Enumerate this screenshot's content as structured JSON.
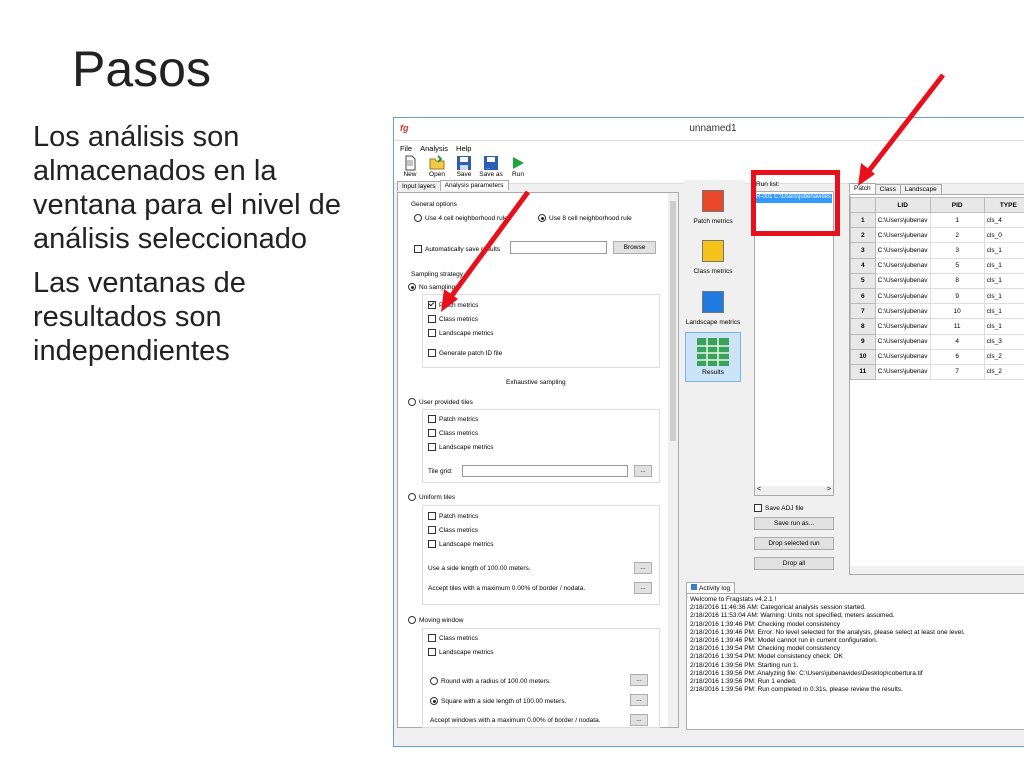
{
  "slide": {
    "title": "Pasos",
    "bullets": [
      "Los análisis son almacenados en la ventana para el nivel de análisis seleccionado",
      "Las ventanas de resultados son independientes"
    ]
  },
  "window": {
    "title": "unnamed1",
    "menu": [
      "File",
      "Analysis",
      "Help"
    ],
    "toolbar": [
      "New",
      "Open",
      "Save",
      "Save as",
      "Run"
    ]
  },
  "left_panel": {
    "tabs": [
      "Input layers",
      "Analysis parameters"
    ],
    "general_options_label": "General options",
    "rule4": "Use 4 cell neighborhood rule",
    "rule8": "Use 8 cell neighborhood rule",
    "auto_save": "Automatically save results",
    "browse": "Browse",
    "sampling_label": "Sampling strategy",
    "no_sampling": "No sampling",
    "patch_metrics": "Patch metrics",
    "class_metrics": "Class metrics",
    "landscape_metrics": "Landscape metrics",
    "generate_patch_id": "Generate patch ID file",
    "exhaustive_sampling": "Exhaustive sampling",
    "user_provided_tiles": "User provided tiles",
    "tile_grid": "Tile grid:",
    "ellipsis": "...",
    "uniform_tiles": "Uniform tiles",
    "side_length": "Use a side length of 100.00 meters.",
    "accept_tiles": "Accept tiles with a maximum 0.00% of border / nodata.",
    "moving_window": "Moving window",
    "round_radius": "Round with a radius of 100.00 meters.",
    "square_side": "Square with a side length of 100.00 meters.",
    "accept_windows": "Accept windows with a maximum 0.00% of border / nodata."
  },
  "metrics_panel": {
    "items": [
      {
        "label": "Patch metrics",
        "color": "#e8472a"
      },
      {
        "label": "Class metrics",
        "color": "#f6c21a"
      },
      {
        "label": "Landscape metrics",
        "color": "#1f7be0"
      },
      {
        "label": "Results",
        "color": "#3aa25b"
      }
    ]
  },
  "run_list": {
    "label": "Run list:",
    "entry": "R-001 C:\\Users\\jubenavides",
    "save_adj": "Save ADJ file",
    "buttons": [
      "Save run as...",
      "Drop selected run",
      "Drop all"
    ]
  },
  "results": {
    "tabs": [
      "Patch",
      "Class",
      "Landscape"
    ],
    "columns": [
      "LID",
      "PID",
      "TYPE"
    ],
    "rows": [
      {
        "n": "1",
        "lid": "C:\\Users\\jubenav",
        "pid": "1",
        "type": "cls_4"
      },
      {
        "n": "2",
        "lid": "C:\\Users\\jubenav",
        "pid": "2",
        "type": "cls_0"
      },
      {
        "n": "3",
        "lid": "C:\\Users\\jubenav",
        "pid": "3",
        "type": "cls_1"
      },
      {
        "n": "4",
        "lid": "C:\\Users\\jubenav",
        "pid": "5",
        "type": "cls_1"
      },
      {
        "n": "5",
        "lid": "C:\\Users\\jubenav",
        "pid": "8",
        "type": "cls_1"
      },
      {
        "n": "6",
        "lid": "C:\\Users\\jubenav",
        "pid": "9",
        "type": "cls_1"
      },
      {
        "n": "7",
        "lid": "C:\\Users\\jubenav",
        "pid": "10",
        "type": "cls_1"
      },
      {
        "n": "8",
        "lid": "C:\\Users\\jubenav",
        "pid": "11",
        "type": "cls_1"
      },
      {
        "n": "9",
        "lid": "C:\\Users\\jubenav",
        "pid": "4",
        "type": "cls_3"
      },
      {
        "n": "10",
        "lid": "C:\\Users\\jubenav",
        "pid": "6",
        "type": "cls_2"
      },
      {
        "n": "11",
        "lid": "C:\\Users\\jubenav",
        "pid": "7",
        "type": "cls_2"
      }
    ]
  },
  "activity_log": {
    "tab": "Activity log",
    "lines": [
      "Welcome to Fragstats v4.2.1 !",
      "2/18/2016 11:46:36 AM: Categorical analysis session started.",
      "2/18/2016 11:53:04 AM: Warning: Units not specified, meters assumed.",
      "2/18/2016 1:39:46 PM: Checking model consistency",
      "2/18/2016 1:39:46 PM: Error: No level selected for the analysis, please select at least one level.",
      "2/18/2016 1:39:46 PM: Model cannot run in current configuration.",
      "2/18/2016 1:39:54 PM: Checking model consistency",
      "2/18/2016 1:39:54 PM: Model consistency check: OK",
      "2/18/2016 1:39:56 PM: Starting run 1.",
      "2/18/2016 1:39:56 PM: Analyzing file: C:\\Users\\jubenavides\\Desktop\\cobertura.tif",
      "2/18/2016 1:39:56 PM: Run 1 ended.",
      "2/18/2016 1:39:56 PM: Run completed in 0.31s, please review the results."
    ]
  },
  "colors": {
    "annotation_red": "#e8101a",
    "selection_blue": "#3399ff"
  }
}
